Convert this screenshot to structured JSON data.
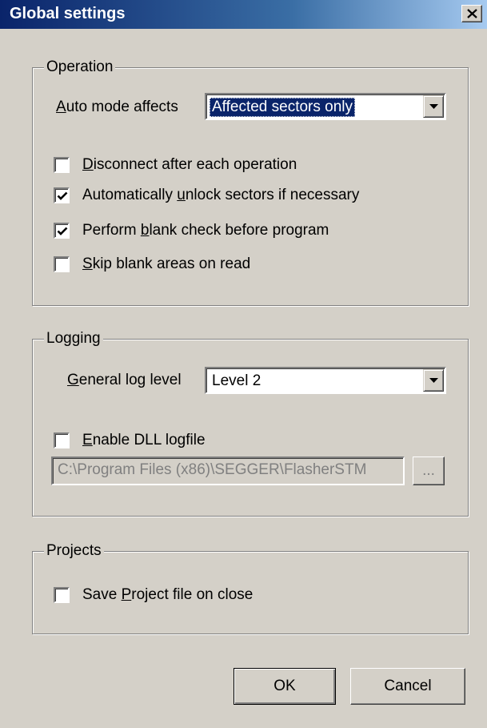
{
  "window": {
    "title": "Global settings"
  },
  "operation": {
    "legend": "Operation",
    "auto_mode_label": "Auto mode affects",
    "auto_mode_value": "Affected sectors only",
    "checkboxes": [
      {
        "label": "Disconnect after each operation",
        "checked": false
      },
      {
        "label": "Automatically unlock sectors if necessary",
        "checked": true
      },
      {
        "label": "Perform blank check before program",
        "checked": true
      },
      {
        "label": "Skip blank areas on read",
        "checked": false
      }
    ]
  },
  "logging": {
    "legend": "Logging",
    "log_level_label": "General log level",
    "log_level_value": "Level 2",
    "enable_dll_label": "Enable DLL logfile",
    "enable_dll_checked": false,
    "logfile_path": "C:\\Program Files (x86)\\SEGGER\\FlasherSTM",
    "browse_label": "..."
  },
  "projects": {
    "legend": "Projects",
    "save_project_label": "Save Project file on close",
    "save_project_checked": false
  },
  "buttons": {
    "ok": "OK",
    "cancel": "Cancel"
  }
}
